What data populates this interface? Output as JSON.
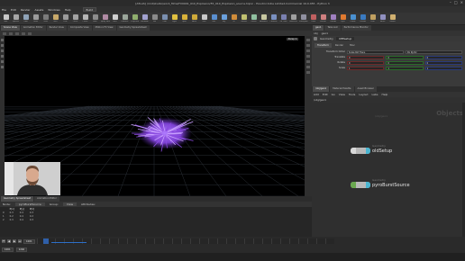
{
  "title": "[ATLAS] /mnt/studio/work_films/FX0001_010_Explosion/FX_010_Explosion_source.hipnc - Houdini Indie Limited-Commercial 19.0.455 - Python 3",
  "window_controls": [
    "–",
    "□",
    "×"
  ],
  "menu": [
    "File",
    "Edit",
    "Render",
    "Assets",
    "Windows",
    "Help"
  ],
  "desktop": "Build",
  "shelf_tools": [
    {
      "label": "Box",
      "color": "#c9c9c9"
    },
    {
      "label": "Sphere",
      "color": "#a6a6a6"
    },
    {
      "label": "Tube",
      "color": "#8fa3b8"
    },
    {
      "label": "Torus",
      "color": "#9a9a9a"
    },
    {
      "label": "Grid",
      "color": "#7b7b7b"
    },
    {
      "label": "Null",
      "color": "#c8a96a"
    },
    {
      "label": "Line",
      "color": "#9b9b9b"
    },
    {
      "label": "Circle",
      "color": "#a3a3a3"
    },
    {
      "label": "Curve",
      "color": "#b5b5b5"
    },
    {
      "label": "Path",
      "color": "#8c8c8c"
    },
    {
      "label": "Spray Paint",
      "color": "#b08aa3"
    },
    {
      "label": "Font",
      "color": "#cfcfcf"
    },
    {
      "label": "Platonic",
      "color": "#9aa59a"
    },
    {
      "label": "L-System",
      "color": "#8fae6d"
    },
    {
      "label": "Metaball",
      "color": "#a2a2d0"
    },
    {
      "label": "File",
      "color": "#8a8a8a"
    },
    {
      "label": "Cam",
      "color": "#7a8fb0"
    },
    {
      "label": "Light",
      "color": "#e0c040"
    },
    {
      "label": "Spot",
      "color": "#d9b23a"
    },
    {
      "label": "Area",
      "color": "#cfaa3a"
    },
    {
      "label": "Geo",
      "color": "#c9c9c9"
    },
    {
      "label": "Env",
      "color": "#5a8fd0"
    },
    {
      "label": "Sky",
      "color": "#6aa0dd"
    },
    {
      "label": "GI",
      "color": "#d08c3a"
    },
    {
      "label": "Caustic",
      "color": "#c0c070"
    },
    {
      "label": "Portal",
      "color": "#90c0a0"
    },
    {
      "label": "Ambient",
      "color": "#c7c7a0"
    },
    {
      "label": "Camera",
      "color": "#7a90c0"
    },
    {
      "label": "VR Cam",
      "color": "#7a80b0"
    },
    {
      "label": "Switcher",
      "color": "#a0a0a0"
    },
    {
      "label": "Gamepad",
      "color": "#9090a0"
    },
    {
      "label": "Cloth",
      "color": "#c06060"
    },
    {
      "label": "Vellum",
      "color": "#d08080"
    },
    {
      "label": "Crowds",
      "color": "#a080c0"
    },
    {
      "label": "Pyro",
      "color": "#e07a30"
    },
    {
      "label": "Fluids",
      "color": "#4a90d0"
    },
    {
      "label": "Oceans",
      "color": "#3a7ac0"
    },
    {
      "label": "FEM",
      "color": "#c0a060"
    },
    {
      "label": "Wires",
      "color": "#9090c0"
    },
    {
      "label": "Grains",
      "color": "#d0b070"
    }
  ],
  "left_tabs": [
    "Scene View",
    "Animation Editor",
    "Render View",
    "Composite View",
    "Motion FX View",
    "Geometry Spreadsheet"
  ],
  "viewport": {
    "camera_menu": "Persp ▾",
    "status": "Set entry dynamics, stop the playing Animation..."
  },
  "sheet": {
    "tabs": [
      "Geometry Spreadsheet",
      "Animation Editor"
    ],
    "bar": [
      "Node:",
      "pyroBurstSource",
      "Group:",
      "View",
      "Attributes:"
    ],
    "headers": [
      "",
      "P[x]",
      "P[y]",
      "P[z]"
    ],
    "rows": [
      [
        "0",
        "0.3",
        "0.4",
        "0.3"
      ],
      [
        "1",
        "0.2",
        "0.4",
        "0.2"
      ],
      [
        "2",
        "0.3",
        "0.4",
        "0.3"
      ]
    ]
  },
  "playbar": {
    "frame": "1001",
    "start": "1001",
    "end": "1240",
    "buttons": [
      "⏮",
      "◀",
      "▶",
      "⏭"
    ],
    "cache_percent": 12
  },
  "right_tabs": [
    "geo1",
    "Take List",
    "Performance Monitor"
  ],
  "right_path": [
    "obj",
    "geo1"
  ],
  "param_title": {
    "type": "Geometry",
    "name": "CEEsetup"
  },
  "param_subtabs": [
    "Transform",
    "Render",
    "Misc"
  ],
  "params": [
    {
      "label": "Transform Order",
      "values": [
        "Scale Rot Trans",
        "Rx Ry Rz"
      ]
    },
    {
      "label": "Translate",
      "values": [
        "0",
        "0",
        "0"
      ]
    },
    {
      "label": "Rotate",
      "values": [
        "0",
        "0",
        "0"
      ]
    },
    {
      "label": "Scale",
      "values": [
        "1",
        "1",
        "1"
      ]
    }
  ],
  "network_tabs": [
    "/obj/geo1",
    "Material Palette",
    "Asset Browser"
  ],
  "network_menu": [
    "Add",
    "Edit",
    "Go",
    "View",
    "Tools",
    "Layout",
    "Labs",
    "Help"
  ],
  "network_path": "/obj/geo1",
  "network_context": "Objects",
  "nodes": [
    {
      "type": "Geometry",
      "name": "oldSetup",
      "left_color": "#d8d8d8",
      "right_color": "#4ab5d0"
    },
    {
      "type": "Geometry",
      "name": "pyroBurstSource",
      "left_color": "#6aa84f",
      "right_color": "#4ab5d0"
    }
  ]
}
